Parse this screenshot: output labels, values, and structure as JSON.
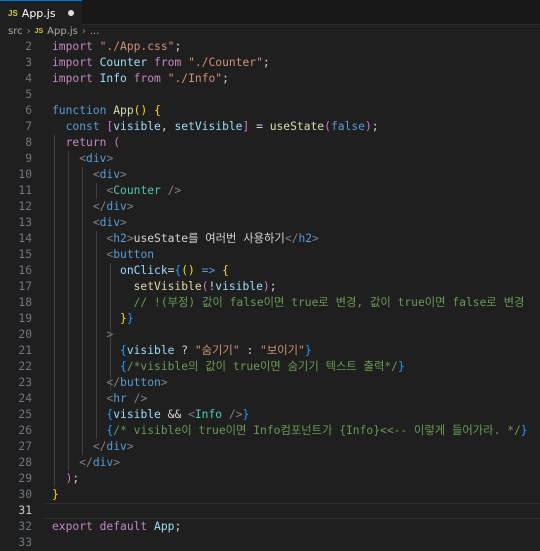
{
  "tab": {
    "badge": "JS",
    "filename": "App.js"
  },
  "breadcrumb": {
    "folder": "src",
    "badge": "JS",
    "file": "App.js",
    "more": "..."
  },
  "line_numbers": [
    "2",
    "3",
    "4",
    "5",
    "6",
    "7",
    "8",
    "9",
    "10",
    "11",
    "12",
    "13",
    "14",
    "15",
    "16",
    "17",
    "18",
    "19",
    "20",
    "21",
    "22",
    "23",
    "24",
    "25",
    "26",
    "27",
    "28",
    "29",
    "30",
    "31",
    "32",
    "33"
  ],
  "active_line": "31",
  "code": {
    "l2": [
      [
        "c",
        "import"
      ],
      [
        "w",
        " "
      ],
      [
        "s",
        "\"./App.css\""
      ],
      [
        "w",
        ";"
      ]
    ],
    "l3": [
      [
        "c",
        "import"
      ],
      [
        "w",
        " "
      ],
      [
        "v",
        "Counter"
      ],
      [
        "w",
        " "
      ],
      [
        "c",
        "from"
      ],
      [
        "w",
        " "
      ],
      [
        "s",
        "\"./Counter\""
      ],
      [
        "w",
        ";"
      ]
    ],
    "l4": [
      [
        "c",
        "import"
      ],
      [
        "w",
        " "
      ],
      [
        "v",
        "Info"
      ],
      [
        "w",
        " "
      ],
      [
        "c",
        "from"
      ],
      [
        "w",
        " "
      ],
      [
        "s",
        "\"./Info\""
      ],
      [
        "w",
        ";"
      ]
    ],
    "l5": [],
    "l6": [
      [
        "k",
        "function"
      ],
      [
        "w",
        " "
      ],
      [
        "f",
        "App"
      ],
      [
        "b1",
        "()"
      ],
      [
        "w",
        " "
      ],
      [
        "b1",
        "{"
      ]
    ],
    "l7": [
      [
        "w",
        "  "
      ],
      [
        "k",
        "const"
      ],
      [
        "w",
        " "
      ],
      [
        "b2",
        "["
      ],
      [
        "v",
        "visible"
      ],
      [
        "w",
        ", "
      ],
      [
        "v",
        "setVisible"
      ],
      [
        "b2",
        "]"
      ],
      [
        "w",
        " = "
      ],
      [
        "f",
        "useState"
      ],
      [
        "b2",
        "("
      ],
      [
        "k",
        "false"
      ],
      [
        "b2",
        ")"
      ],
      [
        "w",
        ";"
      ]
    ],
    "l8": [
      [
        "w",
        "  "
      ],
      [
        "c",
        "return"
      ],
      [
        "w",
        " "
      ],
      [
        "b2",
        "("
      ]
    ],
    "l9": [
      [
        "w",
        "    "
      ],
      [
        "p",
        "<"
      ],
      [
        "k",
        "div"
      ],
      [
        "p",
        ">"
      ]
    ],
    "l10": [
      [
        "w",
        "      "
      ],
      [
        "p",
        "<"
      ],
      [
        "k",
        "div"
      ],
      [
        "p",
        ">"
      ]
    ],
    "l11": [
      [
        "w",
        "        "
      ],
      [
        "p",
        "<"
      ],
      [
        "t",
        "Counter"
      ],
      [
        "w",
        " "
      ],
      [
        "p",
        "/>"
      ]
    ],
    "l12": [
      [
        "w",
        "      "
      ],
      [
        "p",
        "</"
      ],
      [
        "k",
        "div"
      ],
      [
        "p",
        ">"
      ]
    ],
    "l13": [
      [
        "w",
        "      "
      ],
      [
        "p",
        "<"
      ],
      [
        "k",
        "div"
      ],
      [
        "p",
        ">"
      ]
    ],
    "l14": [
      [
        "w",
        "        "
      ],
      [
        "p",
        "<"
      ],
      [
        "k",
        "h2"
      ],
      [
        "p",
        ">"
      ],
      [
        "w",
        "useState를 여러번 사용하기"
      ],
      [
        "p",
        "</"
      ],
      [
        "k",
        "h2"
      ],
      [
        "p",
        ">"
      ]
    ],
    "l15": [
      [
        "w",
        "        "
      ],
      [
        "p",
        "<"
      ],
      [
        "k",
        "button"
      ]
    ],
    "l16": [
      [
        "w",
        "          "
      ],
      [
        "v",
        "onClick"
      ],
      [
        "w",
        "="
      ],
      [
        "b3",
        "{"
      ],
      [
        "b1",
        "()"
      ],
      [
        "w",
        " "
      ],
      [
        "k",
        "=>"
      ],
      [
        "w",
        " "
      ],
      [
        "b1",
        "{"
      ]
    ],
    "l17": [
      [
        "w",
        "            "
      ],
      [
        "f",
        "setVisible"
      ],
      [
        "b2",
        "("
      ],
      [
        "w",
        "!"
      ],
      [
        "v",
        "visible"
      ],
      [
        "b2",
        ")"
      ],
      [
        "w",
        ";"
      ]
    ],
    "l18": [
      [
        "w",
        "            "
      ],
      [
        "cm",
        "// !(부정) 값이 false이면 true로 변경, 값이 true이면 false로 변경"
      ]
    ],
    "l19": [
      [
        "w",
        "          "
      ],
      [
        "b1",
        "}"
      ],
      [
        "b3",
        "}"
      ]
    ],
    "l20": [
      [
        "w",
        "        "
      ],
      [
        "p",
        ">"
      ]
    ],
    "l21": [
      [
        "w",
        "          "
      ],
      [
        "b3",
        "{"
      ],
      [
        "v",
        "visible"
      ],
      [
        "w",
        " ? "
      ],
      [
        "s",
        "\"숨기기\""
      ],
      [
        "w",
        " : "
      ],
      [
        "s",
        "\"보이기\""
      ],
      [
        "b3",
        "}"
      ]
    ],
    "l22": [
      [
        "w",
        "          "
      ],
      [
        "b3",
        "{"
      ],
      [
        "cm",
        "/*visible의 값이 true이면 숨기기 텍스트 출력*/"
      ],
      [
        "b3",
        "}"
      ]
    ],
    "l23": [
      [
        "w",
        "        "
      ],
      [
        "p",
        "</"
      ],
      [
        "k",
        "button"
      ],
      [
        "p",
        ">"
      ]
    ],
    "l24": [
      [
        "w",
        "        "
      ],
      [
        "p",
        "<"
      ],
      [
        "k",
        "hr"
      ],
      [
        "w",
        " "
      ],
      [
        "p",
        "/>"
      ]
    ],
    "l25": [
      [
        "w",
        "        "
      ],
      [
        "b3",
        "{"
      ],
      [
        "v",
        "visible"
      ],
      [
        "w",
        " && "
      ],
      [
        "p",
        "<"
      ],
      [
        "t",
        "Info"
      ],
      [
        "w",
        " "
      ],
      [
        "p",
        "/>"
      ],
      [
        "b3",
        "}"
      ]
    ],
    "l26": [
      [
        "w",
        "        "
      ],
      [
        "b3",
        "{"
      ],
      [
        "cm",
        "/* visible이 true이면 Info컴포넌트가 {Info}<<-- 이렇게 들어가라. */"
      ],
      [
        "b3",
        "}"
      ]
    ],
    "l27": [
      [
        "w",
        "      "
      ],
      [
        "p",
        "</"
      ],
      [
        "k",
        "div"
      ],
      [
        "p",
        ">"
      ]
    ],
    "l28": [
      [
        "w",
        "    "
      ],
      [
        "p",
        "</"
      ],
      [
        "k",
        "div"
      ],
      [
        "p",
        ">"
      ]
    ],
    "l29": [
      [
        "w",
        "  "
      ],
      [
        "b2",
        ")"
      ],
      [
        "w",
        ";"
      ]
    ],
    "l30": [
      [
        "b1",
        "}"
      ]
    ],
    "l31": [],
    "l32": [
      [
        "c",
        "export"
      ],
      [
        "w",
        " "
      ],
      [
        "c",
        "default"
      ],
      [
        "w",
        " "
      ],
      [
        "v",
        "App"
      ],
      [
        "w",
        ";"
      ]
    ],
    "l33": []
  },
  "colors": {
    "background": "#1f1f1f",
    "tab_accent": "#0078d4",
    "keyword": "#569cd6",
    "control": "#c586c0",
    "string": "#ce9178",
    "function": "#dcdcaa",
    "variable": "#9cdcfe",
    "component": "#4ec9b0",
    "comment": "#6a9955"
  }
}
